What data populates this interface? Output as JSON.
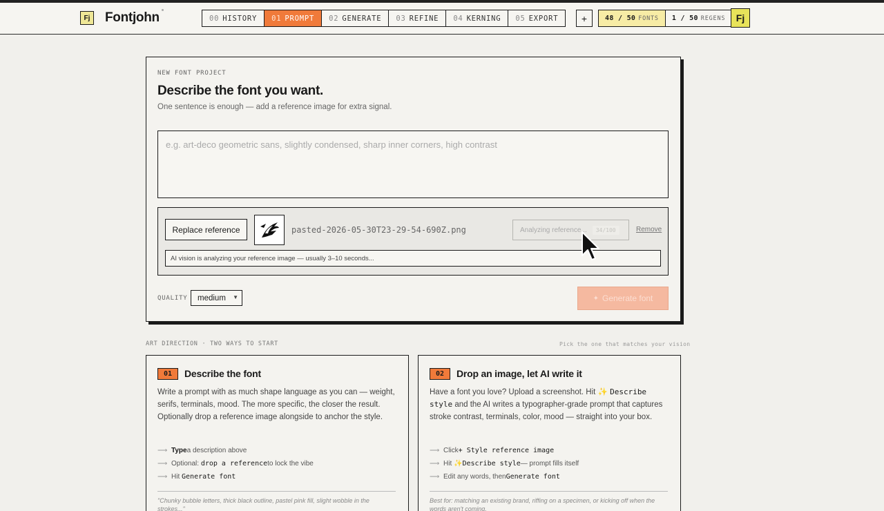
{
  "header": {
    "logo": "Fj",
    "brand": "Fontjohn",
    "steps": [
      {
        "num": "00",
        "label": "HISTORY"
      },
      {
        "num": "01",
        "label": "PROMPT"
      },
      {
        "num": "02",
        "label": "GENERATE"
      },
      {
        "num": "03",
        "label": "REFINE"
      },
      {
        "num": "04",
        "label": "KERNING"
      },
      {
        "num": "05",
        "label": "EXPORT"
      }
    ],
    "active_step": 1,
    "plus": "+",
    "fonts_count": "48 / 50",
    "fonts_label": "FONTS",
    "regens_count": "1 / 50",
    "regens_label": "REGENS",
    "avatar": "Fj"
  },
  "card": {
    "eyebrow": "NEW FONT PROJECT",
    "title": "Describe the font you want.",
    "subtitle": "One sentence is enough — add a reference image for extra signal.",
    "prompt_placeholder": "e.g. art-deco geometric sans, slightly condensed, sharp inner corners, high contrast",
    "reference": {
      "replace_label": "Replace reference",
      "filename": "pasted-2026-05-30T23-29-54-690Z.png",
      "analyze_label": "Analyzing reference...",
      "analyze_pct": "34/100",
      "remove_label": "Remove",
      "status": "AI vision is analyzing your reference image — usually 3–10 seconds..."
    },
    "quality_label": "QUALITY",
    "quality_value": "medium",
    "generate_label": "Generate font"
  },
  "art_direction": {
    "heading": "ART DIRECTION · TWO WAYS TO START",
    "hint": "Pick the one that matches your vision",
    "options": [
      {
        "badge": "01",
        "title": "Describe the font",
        "body": "Write a prompt with as much shape language as you can — weight, serifs, terminals, mood. The more specific, the closer the result. Optionally drop a reference image alongside to anchor the style.",
        "items": [
          {
            "pre": "Type",
            "mid": " a description above",
            "code": "",
            "post": ""
          },
          {
            "pre": "",
            "mid": "Optional: ",
            "code": "drop a reference",
            "post": " to lock the vibe"
          },
          {
            "pre": "",
            "mid": "Hit ",
            "code": "Generate font",
            "post": ""
          }
        ],
        "foot": "\"Chunky bubble letters, thick black outline, pastel pink fill, slight wobble in the strokes...\""
      },
      {
        "badge": "02",
        "title": "Drop an image, let AI write it",
        "body_pre": "Have a font you love? Upload a screenshot. Hit ✨ ",
        "body_code": "Describe style",
        "body_post": " and the AI writes a typographer-grade prompt that captures stroke contrast, terminals, color, mood — straight into your box.",
        "items": [
          {
            "mid": "Click ",
            "code": "+ Style reference image",
            "post": ""
          },
          {
            "mid": "Hit ✨ ",
            "code": "Describe style",
            "post": " — prompt fills itself"
          },
          {
            "mid": "Edit any words, then ",
            "code": "Generate font",
            "post": ""
          }
        ],
        "foot": "Best for: matching an existing brand, riffing on a specimen, or kicking off when the words aren't coming."
      }
    ]
  },
  "colors": {
    "accent": "#f07a3a",
    "highlight": "#f7eca5",
    "avatar": "#e8e35a",
    "generate_disabled": "#f5b9a0"
  }
}
